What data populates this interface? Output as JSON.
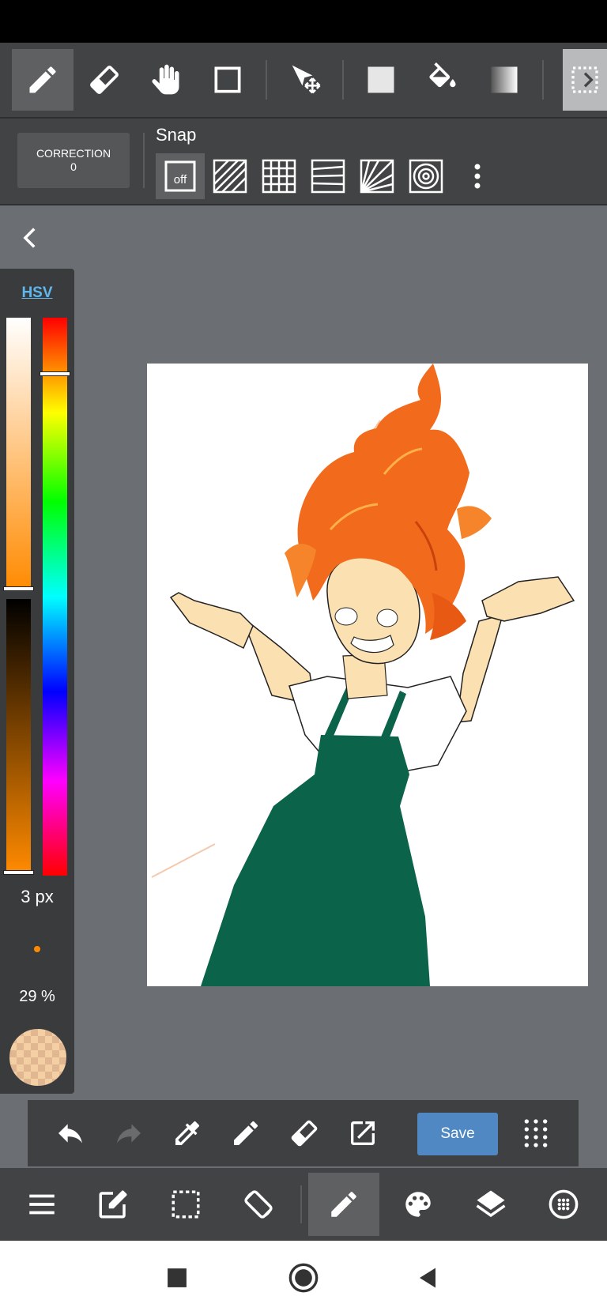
{
  "toolbar": {
    "tools": [
      "pen-tool",
      "eraser-tool",
      "hand-tool",
      "rectangle-tool",
      "move-tool",
      "fill-color-tool",
      "bucket-tool",
      "gradient-tool",
      "selection-tool"
    ],
    "active_tool": "pen-tool"
  },
  "options": {
    "correction_label": "CORRECTION",
    "correction_value": "0",
    "snap_label": "Snap",
    "snap_off_label": "off"
  },
  "color_panel": {
    "mode_label": "HSV",
    "brush_size": "3 px",
    "opacity": "29 %",
    "current_color": "#f4cfa4",
    "accent_color": "#ff8a00"
  },
  "bottom_panel": {
    "save_label": "Save"
  },
  "colors": {
    "toolbar_bg": "#424344",
    "canvas_bg": "#6b6e73",
    "save_button": "#4f88c2",
    "apron": "#0b634a",
    "hair": "#f26a1b",
    "skin": "#fbe0b2"
  }
}
